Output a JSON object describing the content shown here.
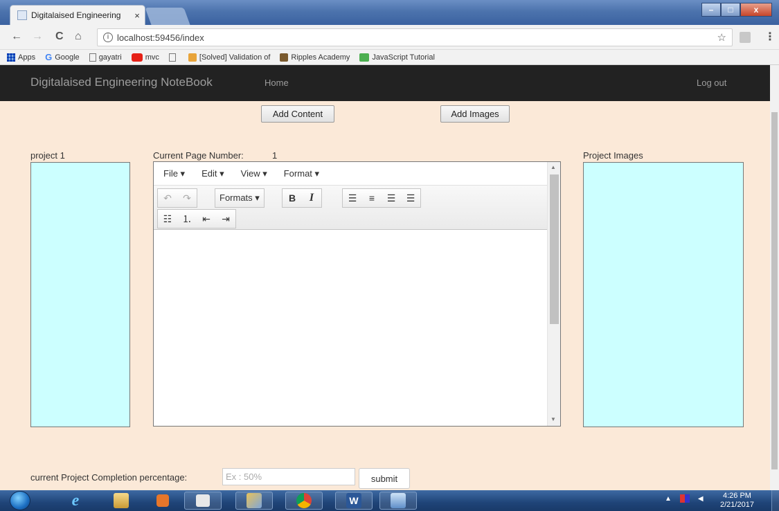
{
  "browser": {
    "tab_title": "Digitalaised Engineering",
    "tab_close": "×",
    "url": "localhost:59456/index",
    "info": "i",
    "star": "☆",
    "back": "←",
    "forward": "→",
    "reload": "C",
    "home": "⌂",
    "menu": "⋮",
    "window_min": "–",
    "window_max": "□",
    "window_close": "x",
    "bookmarks": [
      {
        "label": "Apps"
      },
      {
        "label": "Google"
      },
      {
        "label": "gayatri"
      },
      {
        "label": "mvc"
      },
      {
        "label": ""
      },
      {
        "label": "[Solved] Validation of"
      },
      {
        "label": "Ripples Academy"
      },
      {
        "label": "JavaScript Tutorial"
      }
    ]
  },
  "app": {
    "brand": "Digitalaised Engineering NoteBook",
    "nav_home": "Home",
    "nav_logout": "Log out",
    "add_content": "Add Content",
    "add_images": "Add Images",
    "project_label": "project 1",
    "page_number_label": "Current Page Number:",
    "page_number": "1",
    "images_label": "Project Images",
    "completion_label": "current Project Completion percentage:",
    "completion_placeholder": "Ex : 50%",
    "submit": "submit"
  },
  "editor": {
    "menus": [
      "File ▾",
      "Edit ▾",
      "View ▾",
      "Format ▾"
    ],
    "undo": "↶",
    "redo": "↷",
    "formats": "Formats ▾",
    "bold": "B",
    "italic": "I",
    "align_left": "☰",
    "align_center": "≡",
    "align_right": "☰",
    "align_justify": "☰",
    "bullet_list": "☷",
    "numbered_list": "⒈",
    "outdent": "⇤",
    "indent": "⇥"
  },
  "taskbar": {
    "time": "4:26 PM",
    "date": "2/21/2017"
  },
  "colors": {
    "page_bg": "#fbe9d8",
    "navbar": "#222222",
    "panel": "#ccffff"
  }
}
